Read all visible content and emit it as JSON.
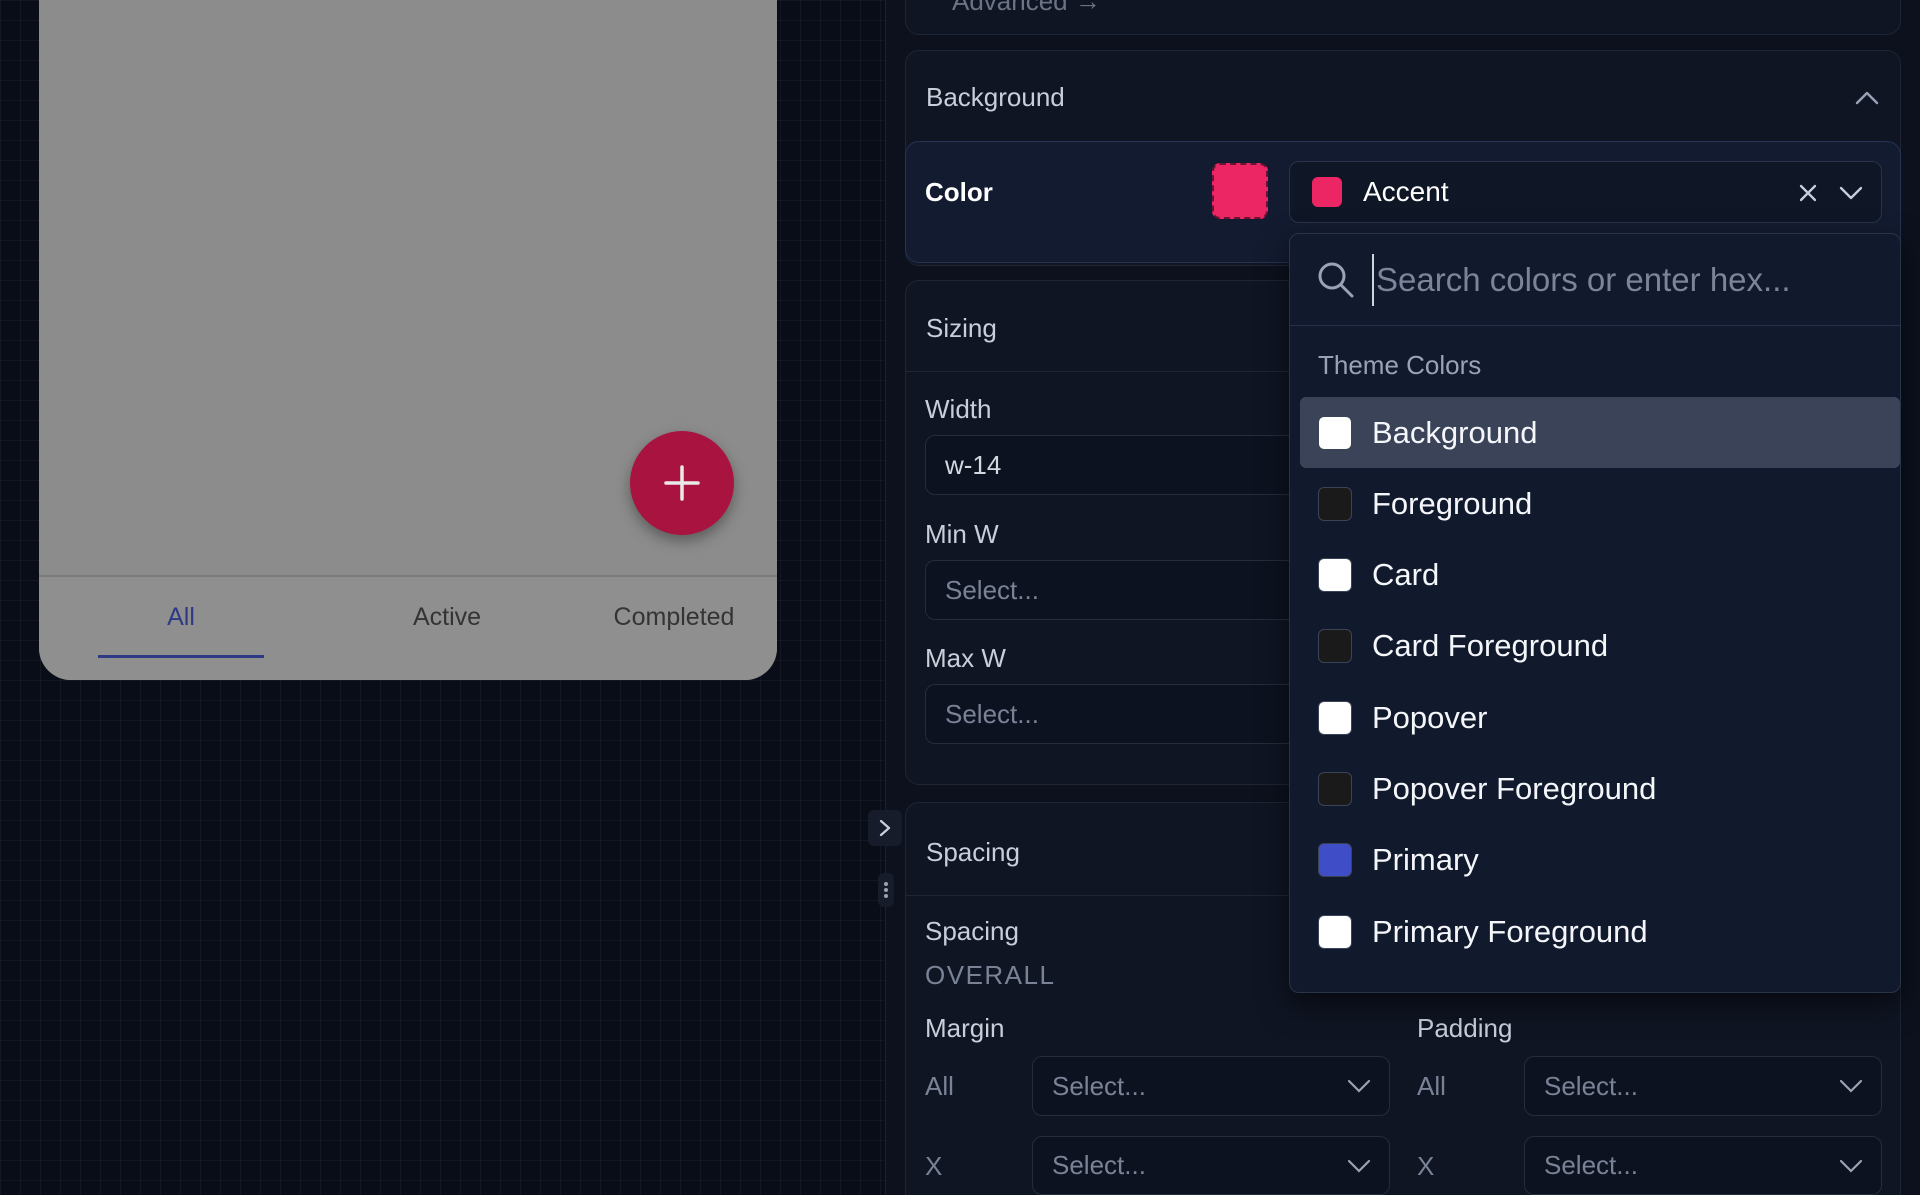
{
  "canvas": {
    "tabs": [
      {
        "label": "All",
        "active": true
      },
      {
        "label": "Active",
        "active": false
      },
      {
        "label": "Completed",
        "active": false
      }
    ],
    "fab_icon": "plus-icon"
  },
  "panel": {
    "advanced_link": "Advanced →",
    "background": {
      "title": "Background",
      "color_label": "Color",
      "selected_color": {
        "name": "Accent",
        "hex": "#ec2564"
      }
    },
    "sizing": {
      "title": "Sizing",
      "width_label": "Width",
      "width_value": "w-14",
      "min_w_label": "Min W",
      "min_w_placeholder": "Select...",
      "max_w_label": "Max W",
      "max_w_placeholder": "Select..."
    },
    "spacing": {
      "title": "Spacing",
      "sub_label": "Spacing",
      "overall_label": "OVERALL",
      "margin_label": "Margin",
      "padding_label": "Padding",
      "rows": [
        {
          "label": "All",
          "placeholder": "Select..."
        },
        {
          "label": "X",
          "placeholder": "Select..."
        }
      ]
    }
  },
  "color_dropdown": {
    "search_placeholder": "Search colors or enter hex...",
    "group_label": "Theme Colors",
    "items": [
      {
        "label": "Background",
        "hex": "#ffffff",
        "highlighted": true
      },
      {
        "label": "Foreground",
        "hex": "#1a1a1a",
        "highlighted": false
      },
      {
        "label": "Card",
        "hex": "#ffffff",
        "highlighted": false
      },
      {
        "label": "Card Foreground",
        "hex": "#1a1a1a",
        "highlighted": false
      },
      {
        "label": "Popover",
        "hex": "#ffffff",
        "highlighted": false
      },
      {
        "label": "Popover Foreground",
        "hex": "#1a1a1a",
        "highlighted": false
      },
      {
        "label": "Primary",
        "hex": "#3f4ec7",
        "highlighted": false
      },
      {
        "label": "Primary Foreground",
        "hex": "#ffffff",
        "highlighted": false
      }
    ]
  }
}
